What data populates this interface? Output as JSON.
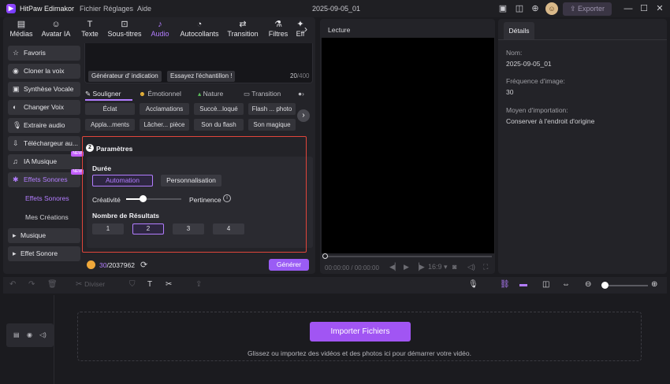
{
  "app": {
    "name": "HitPaw Edimakor",
    "menus": [
      "Fichier",
      "Réglages",
      "Aide"
    ],
    "doc_title": "2025-09-05_01",
    "export_label": "Exporter",
    "avatar_icon": "user-avatar-icon"
  },
  "tabs": [
    {
      "label": "Médias",
      "icon": "media-icon"
    },
    {
      "label": "Avatar IA",
      "icon": "avatar-ai-icon"
    },
    {
      "label": "Texte",
      "icon": "text-icon"
    },
    {
      "label": "Sous-titres",
      "icon": "subtitles-icon"
    },
    {
      "label": "Audio",
      "icon": "audio-icon",
      "active": true
    },
    {
      "label": "Autocollants",
      "icon": "sticker-icon"
    },
    {
      "label": "Transition",
      "icon": "transition-icon"
    },
    {
      "label": "Filtres",
      "icon": "filter-icon"
    },
    {
      "label": "Eff",
      "icon": "effects-icon"
    }
  ],
  "sidebar": {
    "items": [
      {
        "label": "Favoris",
        "icon": "star-icon"
      },
      {
        "label": "Cloner la voix",
        "icon": "voice-clone-icon"
      },
      {
        "label": "Synthèse Vocale",
        "icon": "tts-icon"
      },
      {
        "label": "Changer Voix",
        "icon": "voice-change-icon"
      },
      {
        "label": "Extraire audio",
        "icon": "mic-icon"
      },
      {
        "label": "Téléchargeur au...",
        "icon": "download-icon"
      },
      {
        "label": "IA Musique",
        "icon": "music-ai-icon",
        "badge": "NEW"
      },
      {
        "label": "Effets Sonores",
        "icon": "sound-effects-icon",
        "badge": "NEW",
        "active": true
      }
    ],
    "subitems": [
      {
        "label": "Effets Sonores",
        "active": true
      },
      {
        "label": "Mes Créations"
      }
    ],
    "collapsed": [
      {
        "label": "Musique"
      },
      {
        "label": "Effet Sonore"
      }
    ]
  },
  "prompt": {
    "chips": [
      "Générateur d'  indication",
      "Essayez l'échantillon !"
    ],
    "counter": "20",
    "counter_max": "/400"
  },
  "style_tabs": [
    {
      "label": "Souligner",
      "active": true
    },
    {
      "label": "Émotionnel"
    },
    {
      "label": "Nature"
    },
    {
      "label": "Transition"
    }
  ],
  "sfx_row1": [
    "Éclat",
    "Acclamations",
    "Succè...loqué",
    "Flash ... photo"
  ],
  "sfx_row2": [
    "Appla...ments",
    "Lâcher... pièce",
    "Son du flash",
    "Son magique"
  ],
  "params": {
    "step": "2",
    "title": "Paramètres",
    "duration_label": "Durée",
    "mode_auto": "Automation",
    "mode_custom": "Personnalisation",
    "creativity": "Créativité",
    "relevance": "Pertinence",
    "creativity_value": 0.3,
    "results_label": "Nombre de Résultats",
    "results": [
      "1",
      "2",
      "3",
      "4"
    ],
    "selected_result": "2"
  },
  "footer": {
    "credits_used": "30",
    "credits_total": "/2037962",
    "generate": "Générer"
  },
  "preview": {
    "label": "Lecture",
    "time": "00:00:00 / 00:00:00",
    "ratio": "16:9"
  },
  "details": {
    "tab": "Détails",
    "fields": [
      {
        "k": "Nom:",
        "v": "2025-09-05_01"
      },
      {
        "k": "Fréquence d'image:",
        "v": "30"
      },
      {
        "k": "Moyen d'importation:",
        "v": "Conserver à l'endroit d'origine"
      }
    ]
  },
  "timeline": {
    "split_label": "Diviser",
    "import_button": "Importer Fichiers",
    "hint": "Glissez ou importez des vidéos et des photos ici pour démarrer votre vidéo.",
    "zoom": 0.05
  },
  "colors": {
    "accent": "#b37dff",
    "highlight_border": "#e0453b",
    "import_button": "#a155f3"
  }
}
